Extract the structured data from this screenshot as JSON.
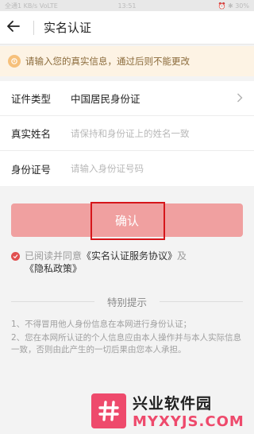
{
  "status_bar": {
    "left": "全通1 KB/s VoLTE",
    "time": "13:51",
    "right": "⏰ ✱ 30%"
  },
  "header": {
    "back_icon": "arrow-left-icon",
    "title": "实名认证"
  },
  "notice": {
    "icon": "info-icon",
    "text": "请输入您的真实信息，通过后则不能更改"
  },
  "form": {
    "id_type": {
      "label": "证件类型",
      "value": "中国居民身份证"
    },
    "real_name": {
      "label": "真实姓名",
      "placeholder": "请保持和身份证上的姓名一致",
      "value": ""
    },
    "id_number": {
      "label": "身份证号",
      "placeholder": "请输入身份证号码",
      "value": ""
    }
  },
  "confirm_label": "确认",
  "agreement": {
    "prefix": "已阅读并同意",
    "link1": "《实名认证服务协议》",
    "connector": "及",
    "link2": "《隐私政策》"
  },
  "tips": {
    "title": "特别提示",
    "items": [
      "1、不得冒用他人身份信息在本网进行身份认证；",
      "2、您在本网所认证的个人信息应由本人操作并与本人实际信息一致，否则由此产生的一切后果由您本人承担。"
    ]
  },
  "watermark": {
    "title": "兴业软件园",
    "url": "MYXYJS.COM"
  },
  "colors": {
    "accent": "#f0a0a0",
    "highlight": "#d6161b",
    "notice_bg": "#fdf3e4"
  }
}
